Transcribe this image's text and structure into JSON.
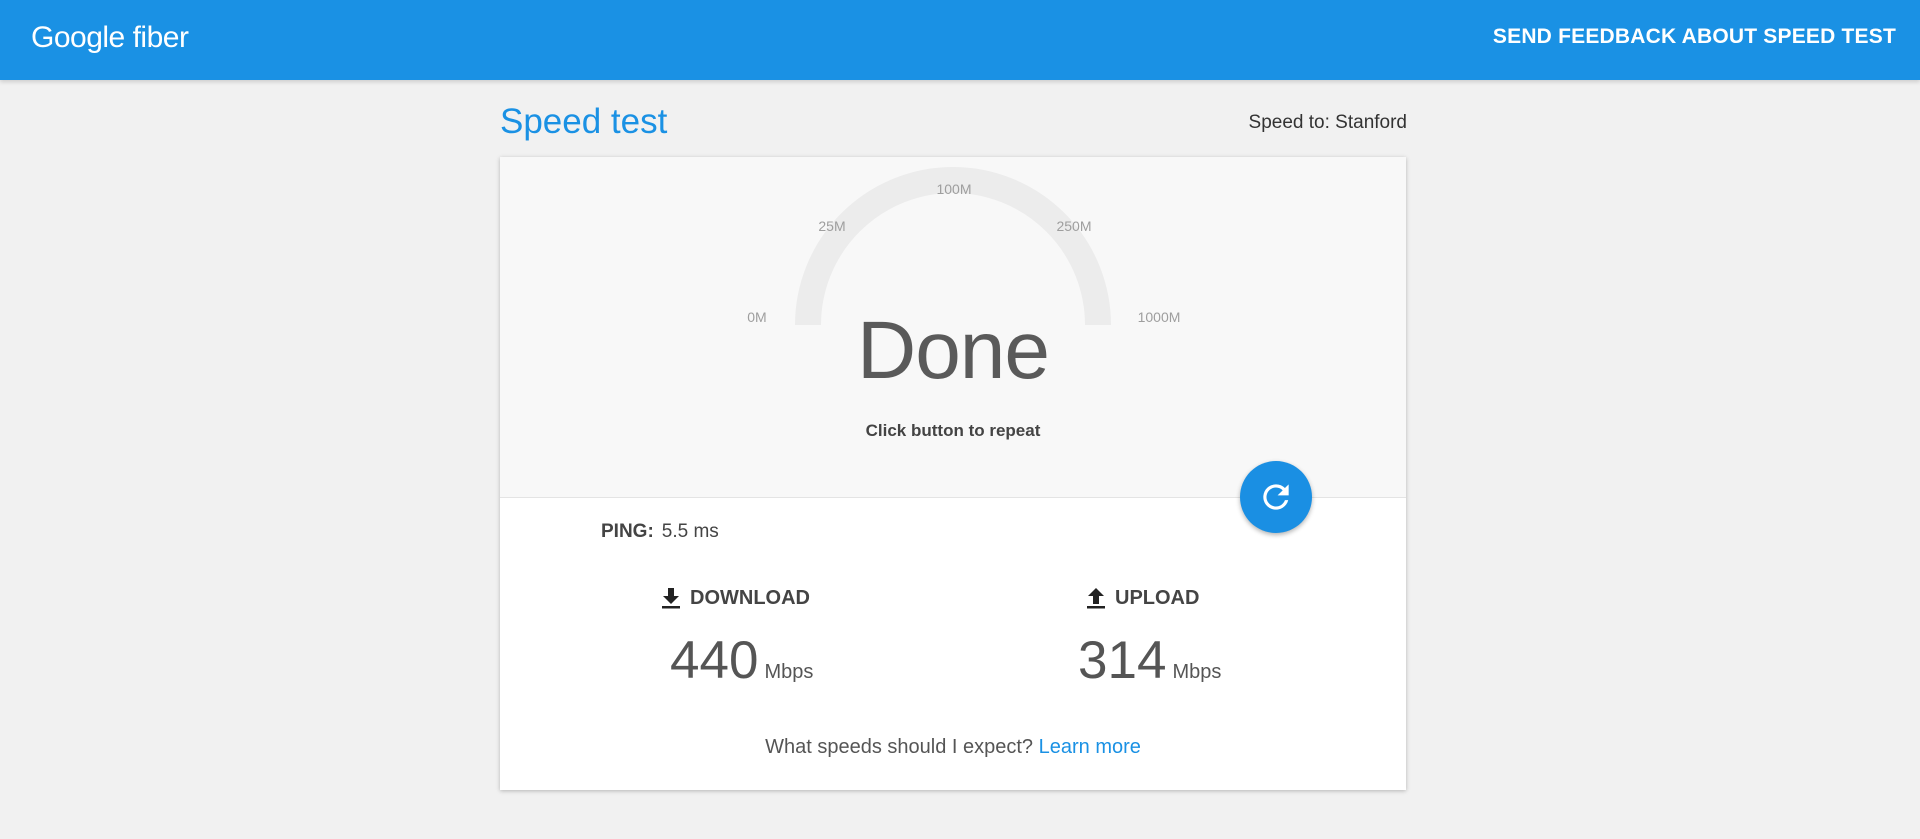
{
  "header": {
    "logo_text": "Google fiber",
    "feedback_label": "SEND FEEDBACK ABOUT SPEED TEST",
    "background_color": "#1a91e4"
  },
  "page": {
    "title": "Speed test",
    "speed_to": "Speed to: Stanford"
  },
  "gauge": {
    "ticks": [
      "0M",
      "25M",
      "100M",
      "250M",
      "1000M"
    ],
    "status": "Done",
    "hint": "Click button to repeat",
    "track_color": "#ececec"
  },
  "repeat_button": {
    "icon": "refresh-icon",
    "color": "#1a8fe3"
  },
  "results": {
    "ping_label": "PING:",
    "ping_value": "5.5 ms",
    "download": {
      "icon": "download-arrow-icon",
      "label": "DOWNLOAD",
      "value": "440",
      "unit": "Mbps"
    },
    "upload": {
      "icon": "upload-arrow-icon",
      "label": "UPLOAD",
      "value": "314",
      "unit": "Mbps"
    }
  },
  "footer": {
    "question": "What speeds should I expect?",
    "link": "Learn more"
  }
}
